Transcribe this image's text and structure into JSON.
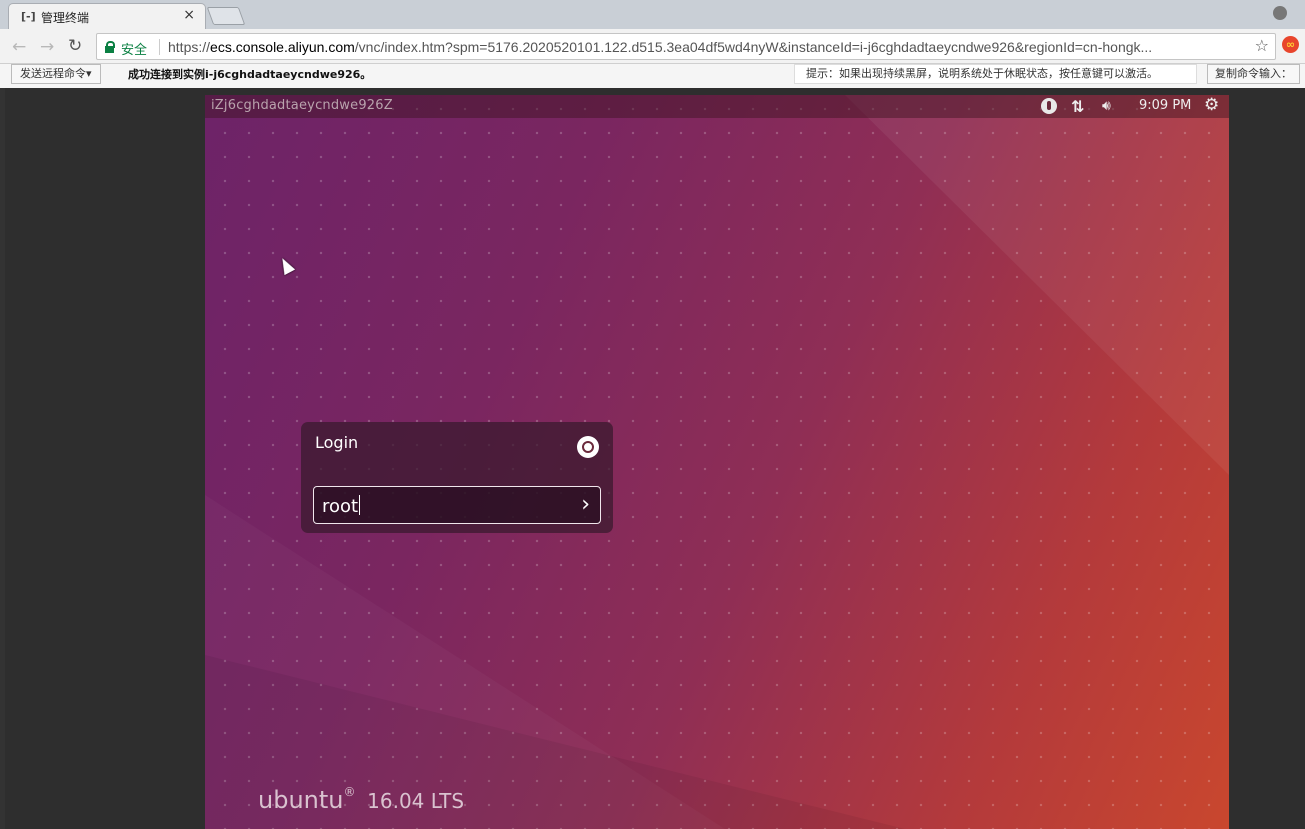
{
  "browser": {
    "tab_title": "管理终端",
    "tab_favicon": "[-]",
    "tab_close": "×",
    "secure_label": "安全",
    "url_scheme": "https://",
    "url_host": "ecs.console.aliyun.com",
    "url_path": "/vnc/index.htm?spm=5176.2020520101.122.d515.3ea04df5wd4nyW&instanceId=i-j6cghdadtaeycndwe926&regionId=cn-hongk..."
  },
  "vnc_toolbar": {
    "send_command_label": "发送远程命令▾",
    "status_text": "成功连接到实例i-j6cghdadtaeycndwe926。",
    "hint_text": "提示：如果出现持续黑屏，说明系统处于休眠状态，按任意键可以激活。",
    "copy_command_label": "复制命令输入："
  },
  "desktop": {
    "hostname": "iZj6cghdadtaeycndwe926Z",
    "clock": "9:09 PM",
    "login_title": "Login",
    "login_value": "root",
    "brand_word": "ubuntu",
    "brand_mark": "®",
    "brand_version": "16.04 LTS"
  },
  "icons": {
    "back": "back-arrow-icon",
    "forward": "forward-arrow-icon",
    "reload": "reload-icon",
    "star": "bookmark-star-icon",
    "profile": "profile-icon",
    "a11y": "accessibility-icon",
    "network": "network-icon",
    "sound": "sound-icon",
    "gear": "session-gear-icon",
    "ubuntu": "ubuntu-logo-icon",
    "submit": "chevron-right-icon"
  },
  "colors": {
    "secure_green": "#0b8043",
    "desktop_purple": "#6d2368",
    "desktop_orange": "#c9472e"
  }
}
